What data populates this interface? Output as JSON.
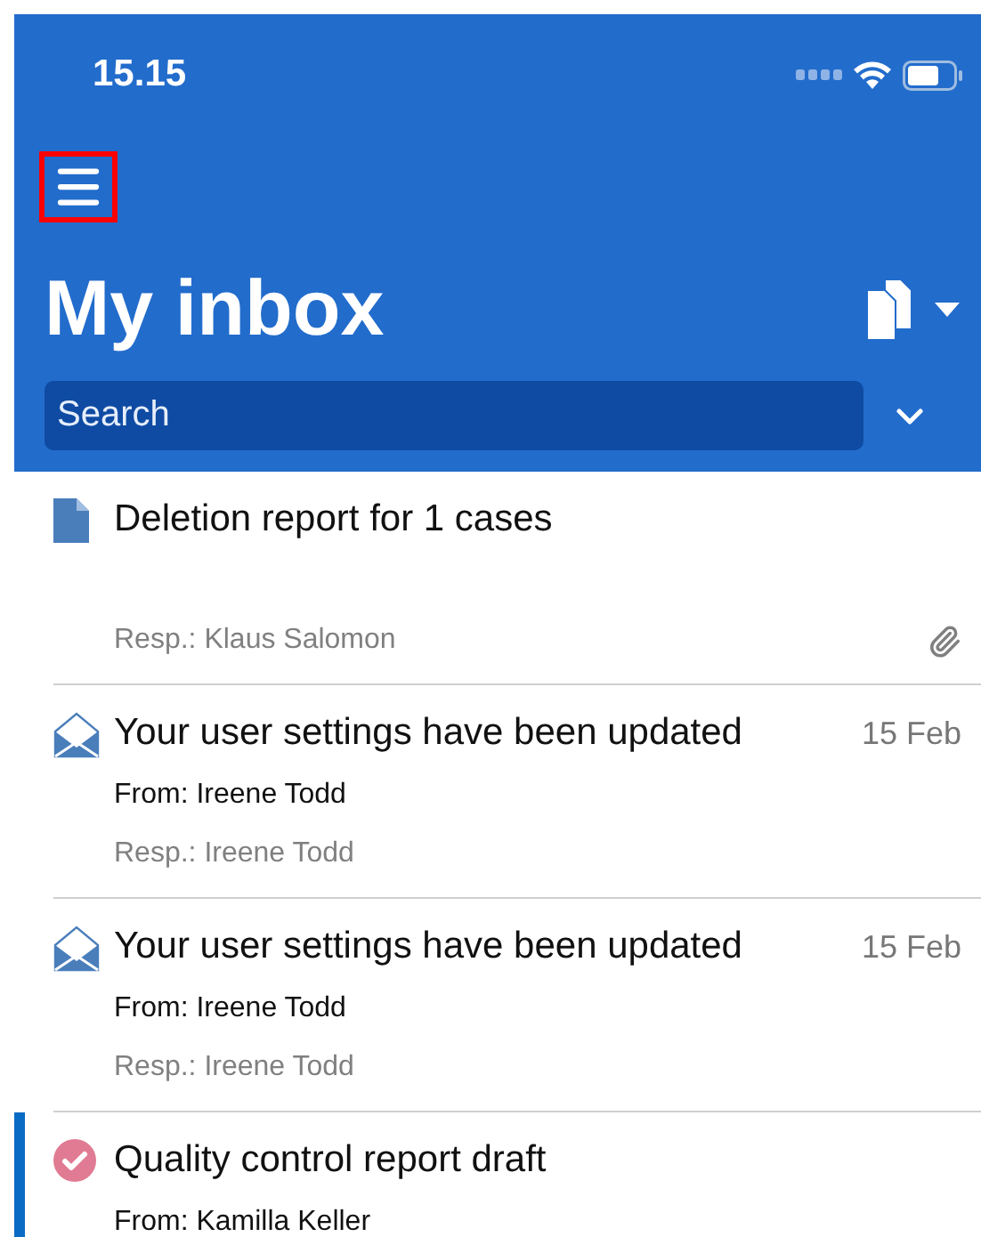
{
  "status_bar": {
    "time": "15.15"
  },
  "header": {
    "title": "My inbox",
    "menu_highlighted": true,
    "search": {
      "placeholder": "Search"
    }
  },
  "items": [
    {
      "kind": "document",
      "title": "Deletion report for 1 cases",
      "responsible": "Resp.: Klaus Salomon",
      "attachment": true,
      "selected": false
    },
    {
      "kind": "message",
      "title": "Your user settings have been updated",
      "date": "15 Feb",
      "from": "From: Ireene Todd",
      "responsible": "Resp.: Ireene Todd",
      "attachment": false,
      "selected": false
    },
    {
      "kind": "message",
      "title": "Your user settings have been updated",
      "date": "15 Feb",
      "from": "From: Ireene Todd",
      "responsible": "Resp.: Ireene Todd",
      "attachment": false,
      "selected": false
    },
    {
      "kind": "task",
      "title": "Quality control report draft",
      "from": "From: Kamilla Keller",
      "attachment": false,
      "selected": true
    }
  ]
}
